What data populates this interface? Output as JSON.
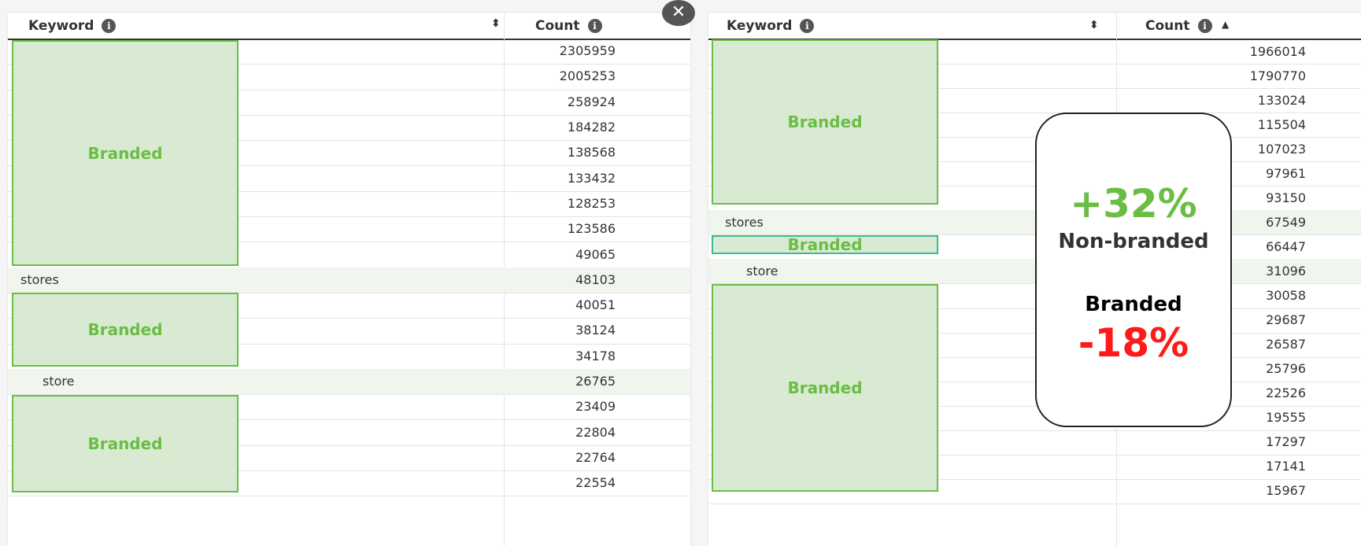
{
  "left_table": {
    "header": {
      "keyword_label": "Keyword",
      "count_label": "Count"
    },
    "rows": [
      {
        "keyword": "",
        "count": "2305959"
      },
      {
        "keyword": "",
        "count": "2005253"
      },
      {
        "keyword": "",
        "count": "258924"
      },
      {
        "keyword": "",
        "count": "184282"
      },
      {
        "keyword": "",
        "count": "138568"
      },
      {
        "keyword": "",
        "count": "133432"
      },
      {
        "keyword": "",
        "count": "128253"
      },
      {
        "keyword": "",
        "count": "123586"
      },
      {
        "keyword": "",
        "count": "49065"
      },
      {
        "keyword": "stores",
        "count": "48103"
      },
      {
        "keyword": "",
        "count": "40051"
      },
      {
        "keyword": "",
        "count": "38124"
      },
      {
        "keyword": "",
        "count": "34178"
      },
      {
        "keyword": "store",
        "count": "26765"
      },
      {
        "keyword": "",
        "count": "23409"
      },
      {
        "keyword": "",
        "count": "22804"
      },
      {
        "keyword": "",
        "count": "22764"
      },
      {
        "keyword": "",
        "count": "22554"
      }
    ],
    "overlay_labels": [
      "Branded",
      "Branded",
      "Branded"
    ]
  },
  "right_table": {
    "header": {
      "keyword_label": "Keyword",
      "count_label": "Count"
    },
    "rows": [
      {
        "keyword": "",
        "count": "1966014"
      },
      {
        "keyword": "",
        "count": "1790770"
      },
      {
        "keyword": "",
        "count": "133024"
      },
      {
        "keyword": "",
        "count": "115504"
      },
      {
        "keyword": "",
        "count": "107023"
      },
      {
        "keyword": "",
        "count": "97961"
      },
      {
        "keyword": "",
        "count": "93150"
      },
      {
        "keyword": "stores",
        "count": "67549"
      },
      {
        "keyword": "",
        "count": "66447"
      },
      {
        "keyword": "store",
        "count": "31096"
      },
      {
        "keyword": "",
        "count": "30058"
      },
      {
        "keyword": "",
        "count": "29687"
      },
      {
        "keyword": "",
        "count": "26587"
      },
      {
        "keyword": "",
        "count": "25796"
      },
      {
        "keyword": "",
        "count": "22526"
      },
      {
        "keyword": "",
        "count": "19555"
      },
      {
        "keyword": "",
        "count": "17297"
      },
      {
        "keyword": "",
        "count": "17141"
      },
      {
        "keyword": "",
        "count": "15967"
      }
    ],
    "overlay_labels": [
      "Branded",
      "Branded",
      "Branded"
    ]
  },
  "callout": {
    "nonbranded_change": "+32%",
    "nonbranded_label": "Non-branded",
    "branded_label": "Branded",
    "branded_change": "-18%"
  },
  "icons": {
    "info": "i",
    "sort_both": "⬍",
    "sort_asc": "▲",
    "close": "✕"
  },
  "colors": {
    "branded_fill": "#d9ead3",
    "branded_border": "#6abd45",
    "positive": "#6abd45",
    "negative": "#ff1a1a"
  }
}
